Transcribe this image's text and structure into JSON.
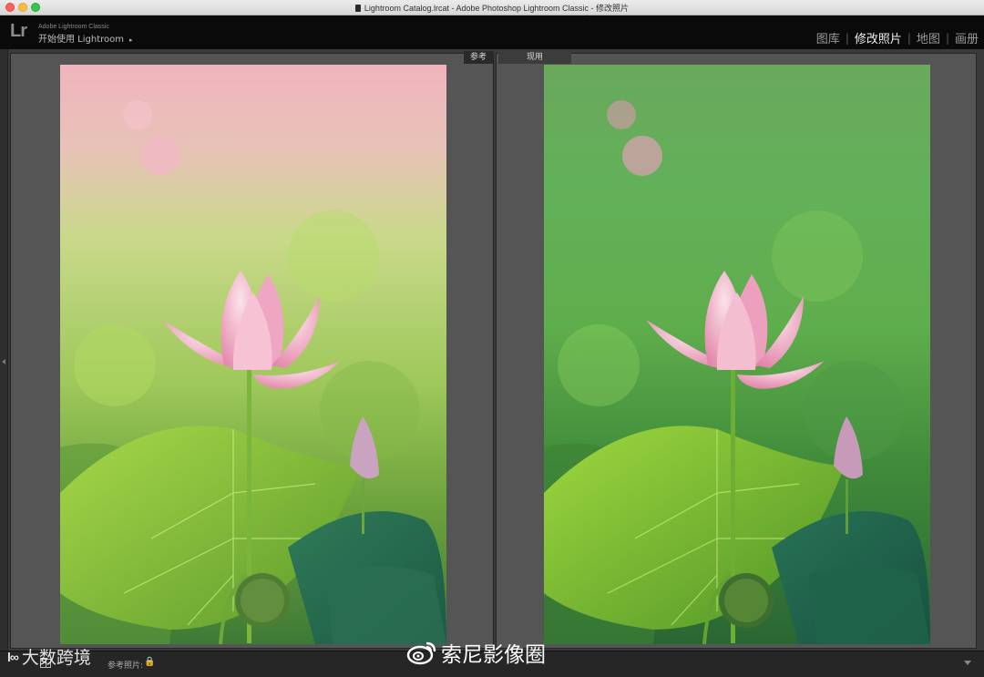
{
  "window": {
    "title": "Lightroom Catalog.lrcat - Adobe Photoshop Lightroom Classic - 修改照片"
  },
  "header": {
    "logo": "Lr",
    "product": "Adobe Lightroom Classic",
    "start_label": "开始使用 Lightroom",
    "start_arrow": "▸"
  },
  "modules": [
    {
      "label": "图库",
      "active": false
    },
    {
      "label": "修改照片",
      "active": true
    },
    {
      "label": "地图",
      "active": false
    },
    {
      "label": "画册",
      "active": false
    }
  ],
  "module_separator": "|",
  "panes": {
    "reference_label": "参考",
    "current_label": "现用"
  },
  "toolbar": {
    "ref_view_label": "参考照片:",
    "lock_icon": "lock-icon"
  },
  "watermarks": {
    "left_logo": "l∞",
    "left_text": "大数跨境",
    "right_text": "索尼影像圈"
  },
  "colors": {
    "active_module": "#efefef",
    "inactive_module": "#9a9a9a",
    "lock": "#d7b44a"
  }
}
